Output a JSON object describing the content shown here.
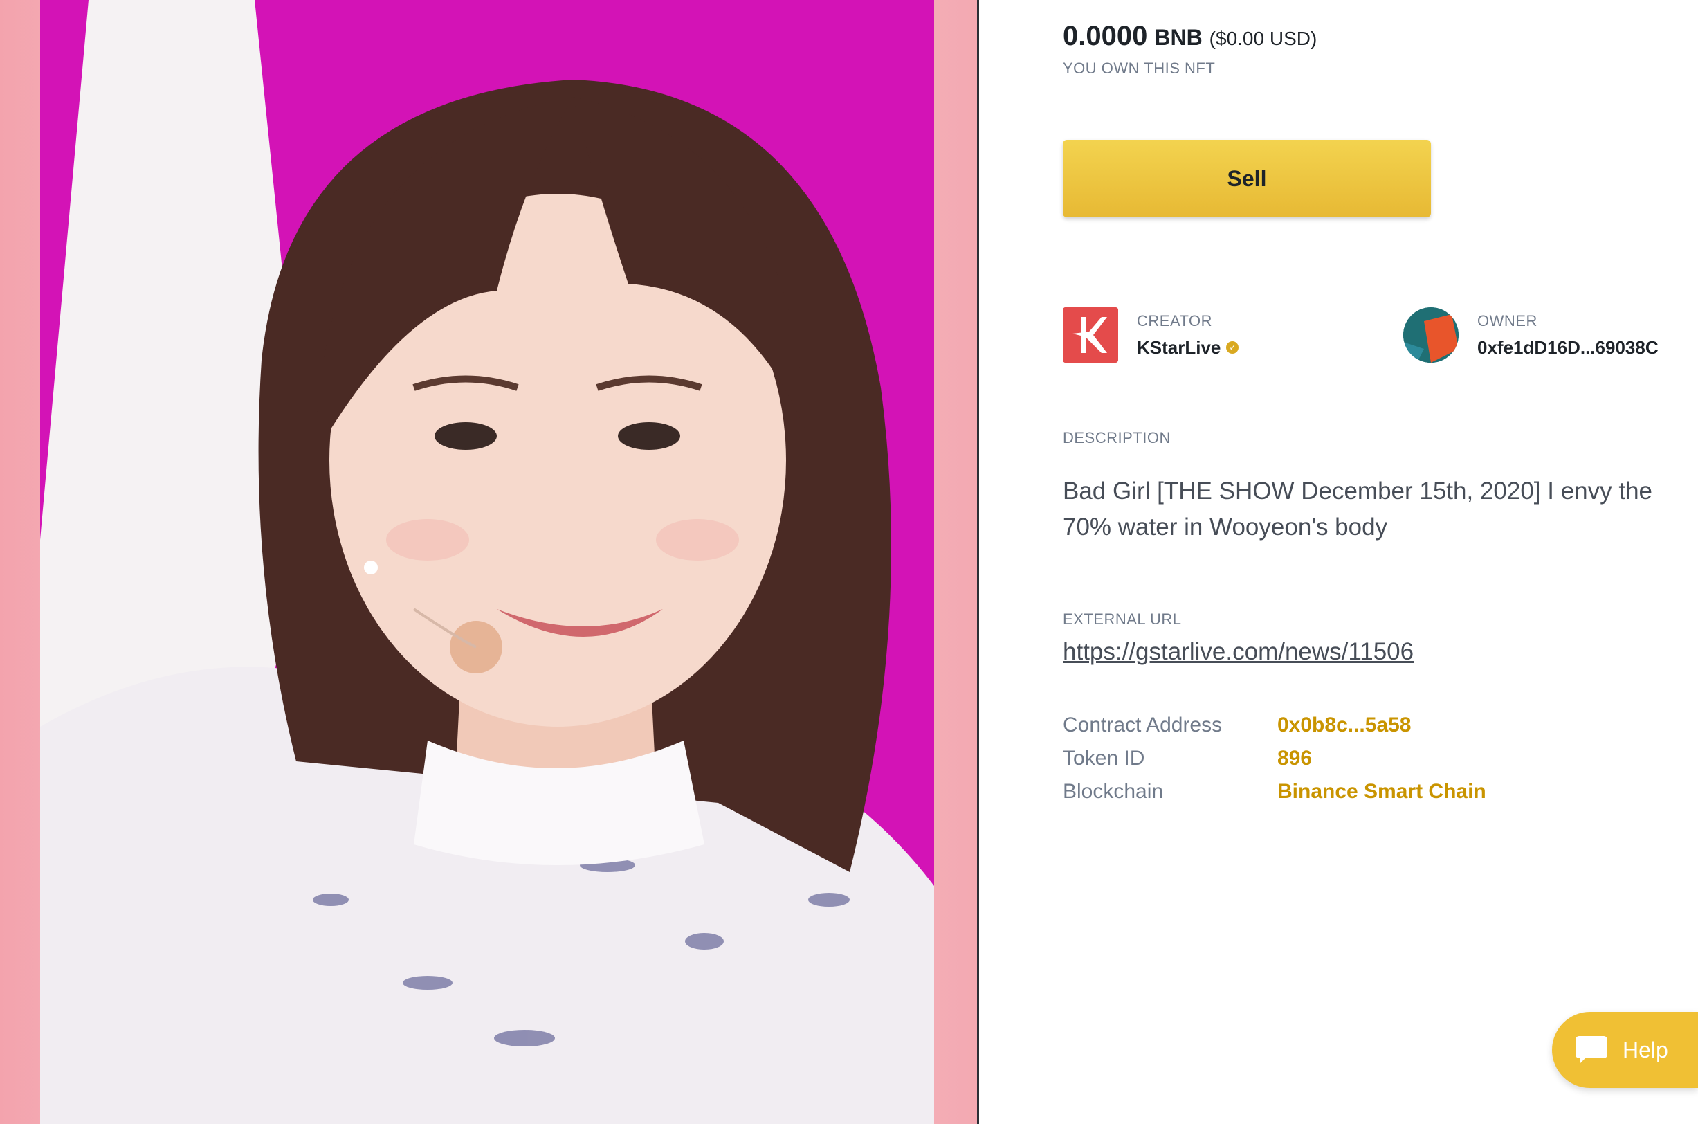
{
  "price": {
    "amount": "0.0000",
    "unit": "BNB",
    "usd": "($0.00 USD)",
    "own_label": "YOU OWN THIS NFT"
  },
  "actions": {
    "sell_label": "Sell"
  },
  "creator": {
    "role": "CREATOR",
    "name": "KStarLive"
  },
  "owner": {
    "role": "OWNER",
    "address": "0xfe1dD16D...69038C"
  },
  "description": {
    "label": "DESCRIPTION",
    "text": "Bad Girl [THE SHOW December 15th, 2020] I envy the 70% water in Wooyeon's body"
  },
  "external": {
    "label": "EXTERNAL URL",
    "url": "https://gstarlive.com/news/11506"
  },
  "details": [
    {
      "key": "Contract Address",
      "value": "0x0b8c...5a58"
    },
    {
      "key": "Token ID",
      "value": "896"
    },
    {
      "key": "Blockchain",
      "value": "Binance Smart Chain"
    }
  ],
  "help": {
    "label": "Help"
  },
  "colors": {
    "accent": "#f0c034",
    "link_gold": "#c99400",
    "media_bg": "#d313b6"
  },
  "icons": {
    "verified": "verified-badge-icon",
    "chat": "chat-bubble-icon"
  }
}
